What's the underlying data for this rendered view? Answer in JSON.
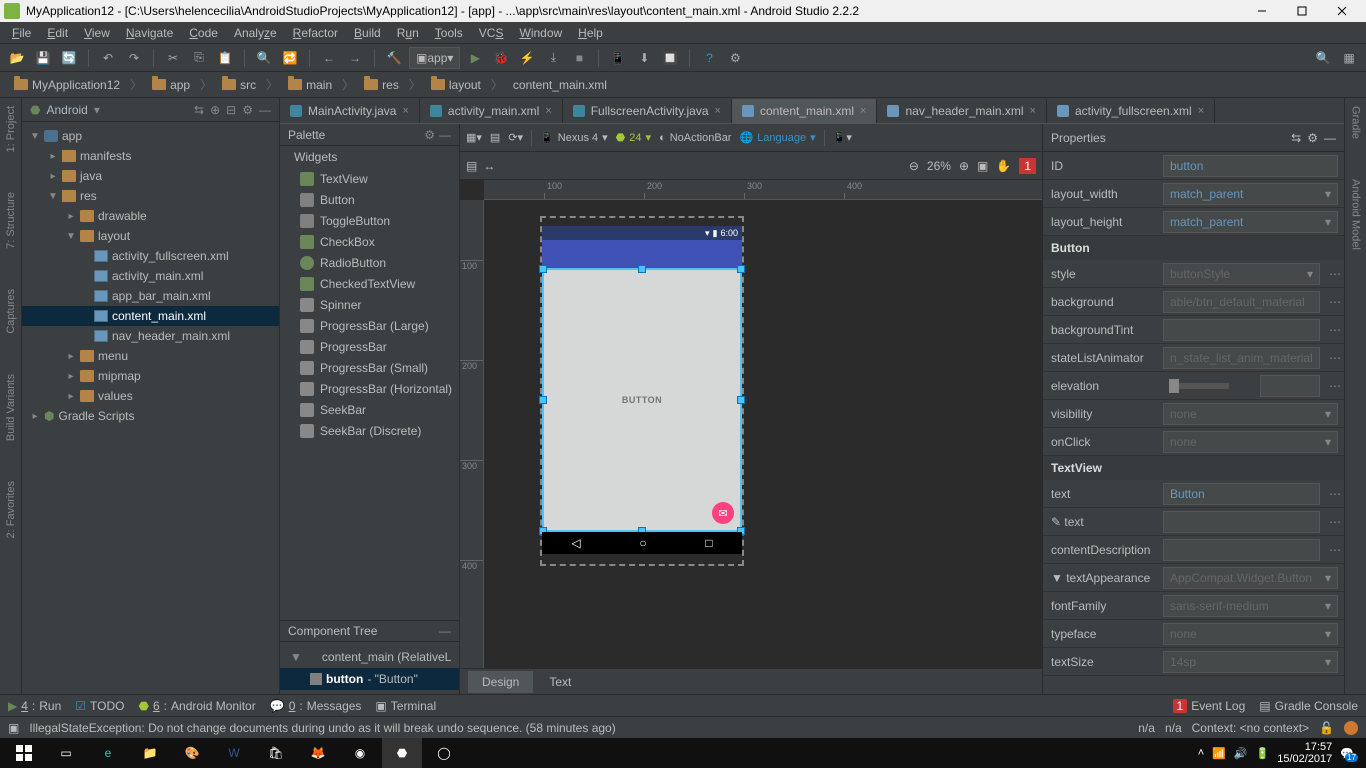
{
  "title": "MyApplication12 - [C:\\Users\\helencecilia\\AndroidStudioProjects\\MyApplication12] - [app] - ...\\app\\src\\main\\res\\layout\\content_main.xml - Android Studio 2.2.2",
  "menu": [
    "File",
    "Edit",
    "View",
    "Navigate",
    "Code",
    "Analyze",
    "Refactor",
    "Build",
    "Run",
    "Tools",
    "VCS",
    "Window",
    "Help"
  ],
  "run_config": "app",
  "breadcrumbs": [
    "MyApplication12",
    "app",
    "src",
    "main",
    "res",
    "layout",
    "content_main.xml"
  ],
  "project_header": "Android",
  "tree": {
    "app": "app",
    "manifests": "manifests",
    "java": "java",
    "res": "res",
    "drawable": "drawable",
    "layout": "layout",
    "layout_files": [
      "activity_fullscreen.xml",
      "activity_main.xml",
      "app_bar_main.xml",
      "content_main.xml",
      "nav_header_main.xml"
    ],
    "menu": "menu",
    "mipmap": "mipmap",
    "values": "values",
    "gradle": "Gradle Scripts"
  },
  "editor_tabs": [
    {
      "label": "MainActivity.java",
      "kind": "java"
    },
    {
      "label": "activity_main.xml",
      "kind": "xml"
    },
    {
      "label": "FullscreenActivity.java",
      "kind": "java"
    },
    {
      "label": "content_main.xml",
      "kind": "xml",
      "active": true
    },
    {
      "label": "nav_header_main.xml",
      "kind": "xml"
    },
    {
      "label": "activity_fullscreen.xml",
      "kind": "xml"
    }
  ],
  "palette_header": "Palette",
  "widgets_header": "Widgets",
  "widgets": [
    "TextView",
    "Button",
    "ToggleButton",
    "CheckBox",
    "RadioButton",
    "CheckedTextView",
    "Spinner",
    "ProgressBar (Large)",
    "ProgressBar",
    "ProgressBar (Small)",
    "ProgressBar (Horizontal)",
    "SeekBar",
    "SeekBar (Discrete)"
  ],
  "component_tree_header": "Component Tree",
  "component_tree": {
    "root": "content_main (RelativeL",
    "child": "button",
    "child_text": " - \"Button\""
  },
  "design_toolbar": {
    "device": "Nexus 4",
    "api": "24",
    "theme": "NoActionBar",
    "lang": "Language"
  },
  "zoom": "26%",
  "preview": {
    "time": "6:00",
    "button_text": "BUTTON"
  },
  "design_tabs": [
    "Design",
    "Text"
  ],
  "props_header": "Properties",
  "properties": [
    {
      "label": "ID",
      "value": "button",
      "type": "text"
    },
    {
      "label": "layout_width",
      "value": "match_parent",
      "type": "select"
    },
    {
      "label": "layout_height",
      "value": "match_parent",
      "type": "select"
    }
  ],
  "section_button": "Button",
  "button_props": [
    {
      "label": "style",
      "value": "buttonStyle",
      "type": "select",
      "more": true
    },
    {
      "label": "background",
      "value": "able/btn_default_material",
      "type": "text",
      "placeholder": true,
      "more": true
    },
    {
      "label": "backgroundTint",
      "value": "",
      "type": "text",
      "more": true
    },
    {
      "label": "stateListAnimator",
      "value": "n_state_list_anim_material",
      "type": "text",
      "placeholder": true,
      "more": true
    },
    {
      "label": "elevation",
      "value": "",
      "type": "slider",
      "more": true
    },
    {
      "label": "visibility",
      "value": "none",
      "type": "select",
      "placeholder": true
    },
    {
      "label": "onClick",
      "value": "none",
      "type": "select",
      "placeholder": true
    }
  ],
  "section_textview": "TextView",
  "textview_props": [
    {
      "label": "text",
      "value": "Button",
      "type": "text",
      "more": true
    },
    {
      "label": "✎ text",
      "value": "",
      "type": "text",
      "more": true
    },
    {
      "label": "contentDescription",
      "value": "",
      "type": "text",
      "more": true
    },
    {
      "label": "▼ textAppearance",
      "value": "AppCompat.Widget.Button",
      "type": "select"
    },
    {
      "label": "fontFamily",
      "value": "sans-serif-medium",
      "type": "select",
      "placeholder": true
    },
    {
      "label": "typeface",
      "value": "none",
      "type": "select",
      "placeholder": true
    },
    {
      "label": "textSize",
      "value": "14sp",
      "type": "select",
      "placeholder": true
    }
  ],
  "bottom_tools": [
    {
      "num": "4",
      "label": "Run",
      "icon": "play",
      "color": "#6a8759"
    },
    {
      "num": "",
      "label": "TODO",
      "icon": "todo"
    },
    {
      "num": "6",
      "label": "Android Monitor",
      "icon": "android"
    },
    {
      "num": "0",
      "label": "Messages",
      "icon": "msg"
    },
    {
      "num": "",
      "label": "Terminal",
      "icon": "term"
    }
  ],
  "bottom_right": [
    {
      "label": "Event Log",
      "icon": "event",
      "badge": "1"
    },
    {
      "label": "Gradle Console",
      "icon": "gradle"
    }
  ],
  "status_msg": "IllegalStateException: Do not change documents during undo as it will break undo sequence. (58 minutes ago)",
  "status_right": {
    "na1": "n/a",
    "na2": "n/a",
    "context": "Context: <no context>"
  },
  "left_rails": [
    "1: Project",
    "7: Structure",
    "Captures",
    "Build Variants",
    "2: Favorites"
  ],
  "right_rails": [
    "Gradle",
    "Android Model"
  ],
  "clock": {
    "time": "17:57",
    "date": "15/02/2017"
  },
  "notif_count": "17"
}
